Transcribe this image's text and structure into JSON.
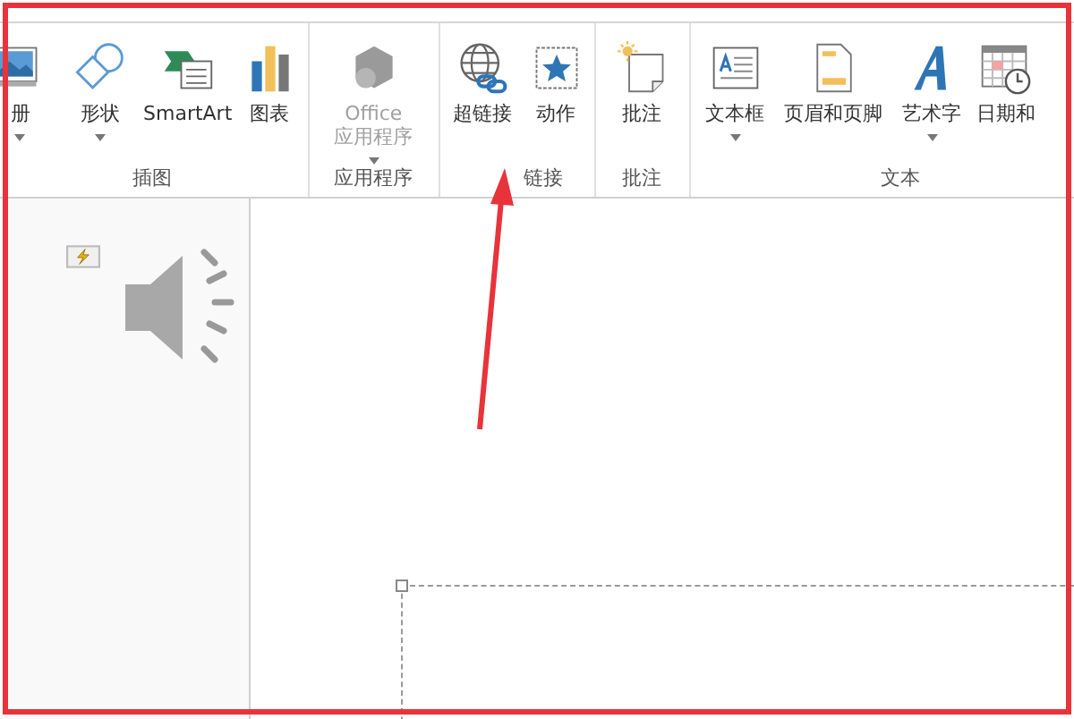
{
  "ribbon": {
    "groups": [
      {
        "label": "插图",
        "buttons": [
          {
            "label": "册",
            "kind": "album",
            "dropdown": true,
            "disabled": false
          },
          {
            "label": "形状",
            "kind": "shapes",
            "dropdown": true,
            "disabled": false
          },
          {
            "label": "SmartArt",
            "kind": "smartart",
            "dropdown": false,
            "disabled": false
          },
          {
            "label": "图表",
            "kind": "chart",
            "dropdown": false,
            "disabled": false
          }
        ]
      },
      {
        "label": "应用程序",
        "buttons": [
          {
            "label": "Office\n应用程序",
            "kind": "office",
            "dropdown": true,
            "disabled": true
          }
        ]
      },
      {
        "label": "链接",
        "buttons": [
          {
            "label": "超链接",
            "kind": "hyperlink",
            "dropdown": false,
            "disabled": false
          },
          {
            "label": "动作",
            "kind": "action",
            "dropdown": false,
            "disabled": false
          }
        ]
      },
      {
        "label": "批注",
        "buttons": [
          {
            "label": "批注",
            "kind": "comment",
            "dropdown": false,
            "disabled": false
          }
        ]
      },
      {
        "label": "文本",
        "buttons": [
          {
            "label": "文本框",
            "kind": "textbox",
            "dropdown": true,
            "disabled": false
          },
          {
            "label": "页眉和页脚",
            "kind": "header",
            "dropdown": false,
            "disabled": false
          },
          {
            "label": "艺术字",
            "kind": "wordart",
            "dropdown": true,
            "disabled": false
          },
          {
            "label": "日期和",
            "kind": "calendar",
            "dropdown": false,
            "disabled": false
          }
        ]
      }
    ]
  }
}
